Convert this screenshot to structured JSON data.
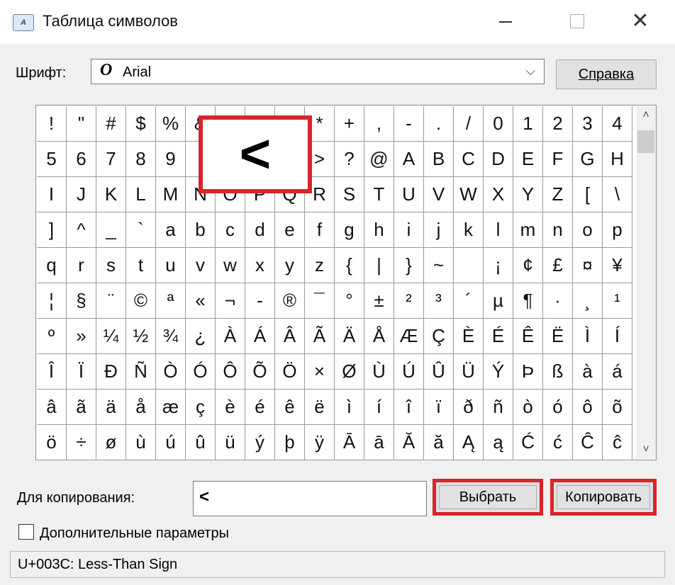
{
  "window": {
    "title": "Таблица символов",
    "icon": "char-map-app-icon",
    "app_icon_glyph": "A"
  },
  "window_controls": {
    "minimize_icon": "minimize-icon",
    "maximize_icon": "maximize-icon",
    "close_glyph": "✕"
  },
  "font_row": {
    "label": "Шрифт:",
    "font_glyph": "O",
    "font_value": "Arial",
    "chevron": "⌵",
    "help_button": "Справка"
  },
  "grid": {
    "rows": [
      [
        "!",
        "\"",
        "#",
        "$",
        "%",
        "&",
        "'",
        "(",
        ")",
        "*",
        "+",
        ",",
        "-",
        ".",
        "/",
        "0",
        "1",
        "2",
        "3",
        "4"
      ],
      [
        "5",
        "6",
        "7",
        "8",
        "9",
        ":",
        ";",
        "<",
        "=",
        ">",
        "?",
        "@",
        "A",
        "B",
        "C",
        "D",
        "E",
        "F",
        "G",
        "H"
      ],
      [
        "I",
        "J",
        "K",
        "L",
        "M",
        "N",
        "O",
        "P",
        "Q",
        "R",
        "S",
        "T",
        "U",
        "V",
        "W",
        "X",
        "Y",
        "Z",
        "[",
        "\\"
      ],
      [
        "]",
        "^",
        "_",
        "`",
        "a",
        "b",
        "c",
        "d",
        "e",
        "f",
        "g",
        "h",
        "i",
        "j",
        "k",
        "l",
        "m",
        "n",
        "o",
        "p"
      ],
      [
        "q",
        "r",
        "s",
        "t",
        "u",
        "v",
        "w",
        "x",
        "y",
        "z",
        "{",
        "|",
        "}",
        "~",
        " ",
        "¡",
        "¢",
        "£",
        "¤",
        "¥"
      ],
      [
        "¦",
        "§",
        "¨",
        "©",
        "ª",
        "«",
        "¬",
        "-",
        "®",
        "¯",
        "°",
        "±",
        "²",
        "³",
        "´",
        "µ",
        "¶",
        "·",
        "¸",
        "¹"
      ],
      [
        "º",
        "»",
        "¼",
        "½",
        "¾",
        "¿",
        "À",
        "Á",
        "Â",
        "Ã",
        "Ä",
        "Å",
        "Æ",
        "Ç",
        "È",
        "É",
        "Ê",
        "Ë",
        "Ì",
        "Í"
      ],
      [
        "Î",
        "Ï",
        "Ð",
        "Ñ",
        "Ò",
        "Ó",
        "Ô",
        "Õ",
        "Ö",
        "×",
        "Ø",
        "Ù",
        "Ú",
        "Û",
        "Ü",
        "Ý",
        "Þ",
        "ß",
        "à",
        "á"
      ],
      [
        "â",
        "ã",
        "ä",
        "å",
        "æ",
        "ç",
        "è",
        "é",
        "ê",
        "ë",
        "ì",
        "í",
        "î",
        "ï",
        "ð",
        "ñ",
        "ò",
        "ó",
        "ô",
        "õ"
      ],
      [
        "ö",
        "÷",
        "ø",
        "ù",
        "ú",
        "û",
        "ü",
        "ý",
        "þ",
        "ÿ",
        "Ā",
        "ā",
        "Ă",
        "ă",
        "Ą",
        "ą",
        "Ć",
        "ć",
        "Ĉ",
        "ĉ"
      ]
    ],
    "selected_char": "<",
    "scroll_up": "˄",
    "scroll_down": "˅"
  },
  "copy_row": {
    "label": "Для копирования:",
    "value": "<",
    "select_button": "Выбрать",
    "copy_button": "Копировать"
  },
  "advanced": {
    "label": "Дополнительные параметры",
    "checked": false
  },
  "status": {
    "text": "U+003C: Less-Than Sign"
  },
  "colors": {
    "highlight_red": "#d8242a",
    "window_bg": "#f0f0f0"
  }
}
